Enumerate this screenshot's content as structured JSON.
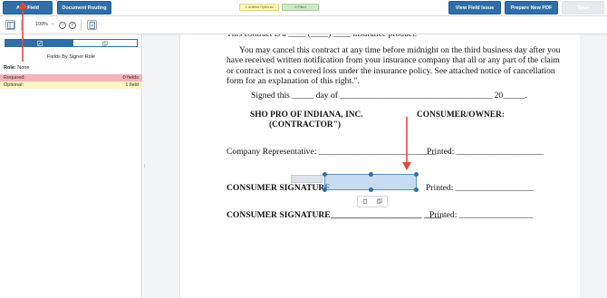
{
  "toolbar": {
    "add_field": "Add Field",
    "document_routing": "Document Routing",
    "view_field_issue": "View Field Issue",
    "prepare_new_pdf": "Prepare New PDF",
    "save": "Save",
    "unfilled_optional": "1 Unfilled Optional",
    "filled": "0 Filled"
  },
  "subtoolbar": {
    "zoom": "109%",
    "zoom_caret": "⌄",
    "zoom_out": "−",
    "zoom_in": "+"
  },
  "left_panel": {
    "title": "Fields By Signer Role",
    "role_label": "Role:",
    "role_value": "None",
    "required_label": "Required:",
    "required_value": "0 fields",
    "optional_label": "Optional:",
    "optional_value": "1 field"
  },
  "document": {
    "top_partial": "This contract is a ____ (____) ____ insurance product.",
    "paragraph": "You may cancel this contract at any time before midnight on the third business day after you have received written notification from your insurance company that all or any part of the claim or contract is not a covered loss under the insurance policy. See attached notice of cancellation form for an explanation of this right.\".",
    "signed_line": "Signed this _____ day of ___________________________________ 20_____.",
    "contractor_line1": "SHO PRO OF INDIANA, INC.",
    "contractor_line2": "(CONTRACTOR\")",
    "consumer_owner": "CONSUMER/OWNER:",
    "company_rep": "Company Representative: ___________________________",
    "printed1": "Printed: ____________________",
    "consumer_sig1": "CONSUMER SIGNATURE",
    "printed2": "Printed: __________________",
    "consumer_sig2": "CONSUMER SIGNATURE_____________________ ____",
    "printed3": "Printed: _________________"
  },
  "colors": {
    "primary": "#2f6ea8",
    "annotation_arrow": "#e0483a",
    "required_bg": "#f5b2b8",
    "optional_bg": "#fbf6bf"
  }
}
